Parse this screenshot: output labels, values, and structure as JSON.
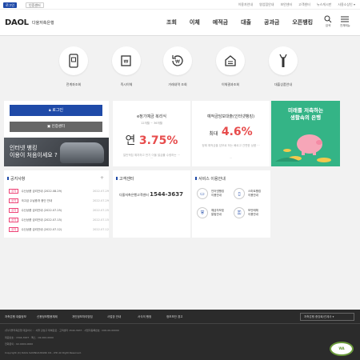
{
  "topbar": {
    "login_label": "로그인",
    "cert_label": "인증센터",
    "links": [
      "이용자안내",
      "영업점안내",
      "보안센터",
      "고객센터",
      "뉴스게시판",
      "고객상담 ▾"
    ],
    "lang_label": "사용소상인 ▾"
  },
  "header": {
    "logo": "DAOL",
    "logo_sub": "다올저축은행",
    "nav": [
      "조회",
      "이체",
      "예적금",
      "대출",
      "공과금",
      "오픈뱅킹"
    ],
    "search_label": "검색",
    "menu_label": "전체메뉴"
  },
  "quick_menu": [
    {
      "label": "전계좌조회",
      "icon": "phone-account-icon"
    },
    {
      "label": "즉시이체",
      "icon": "transfer-doc-icon"
    },
    {
      "label": "거래내역 조회",
      "icon": "history-icon"
    },
    {
      "label": "이체결과조회",
      "icon": "house-result-icon"
    },
    {
      "label": "대출상품안내",
      "icon": "loan-tool-icon"
    }
  ],
  "login_box": {
    "login": "로그인",
    "cert": "인증센터"
  },
  "banner_dark": {
    "line1": "인터넷 뱅킹",
    "line2": "이용이 처음이세요 ?"
  },
  "products": [
    {
      "title": "e정기예금 복리식",
      "sub": "12개월 ~ 36개월",
      "rate_prefix": "연",
      "rate": "3.75%",
      "desc": "일반적립 예치하고 반기 이율 발급률 수령하는 ···",
      "more": "···"
    },
    {
      "title": "예적금담보대출(인터넷뱅킹)",
      "sub": "",
      "rate_prefix": "최대",
      "rate": "4.6%",
      "desc": "정해 예적금을 담보로 하는 빠르고 간편한 상품 ···",
      "more": "···"
    }
  ],
  "green_banner": {
    "line1": "미래를 저축하는",
    "line2": "생활속의 은행"
  },
  "notice": {
    "title": "공지사항",
    "items": [
      {
        "tag": "공지",
        "text": "수신상품 금리안내 (2022.08.29)",
        "date": "2022.07.29"
      },
      {
        "tag": "공지",
        "text": "국고금 수납중개 중단 안내",
        "date": "2022.07.29"
      },
      {
        "tag": "공지",
        "text": "수신상품 금리안내 (2022.07.25)",
        "date": "2022.07.25"
      },
      {
        "tag": "공지",
        "text": "수신상품 금리안내 (2022.07.15)",
        "date": "2022.07.15"
      },
      {
        "tag": "공지",
        "text": "수신상품 금리안내 (2022.07.12)",
        "date": "2022.07.12"
      }
    ]
  },
  "cs": {
    "title": "고객센터",
    "label": "다올저축은행고객센터",
    "phone": "1544-3637"
  },
  "service": {
    "title": "서비스 이용안내",
    "items": [
      {
        "label1": "인터넷뱅킹",
        "label2": "이용안내",
        "icon": "monitor-icon"
      },
      {
        "label1": "스마트뱅킹",
        "label2": "이용안내",
        "icon": "mobile-icon"
      },
      {
        "label1": "예금자보호",
        "label2": "알림안내",
        "icon": "shield-icon"
      },
      {
        "label1": "보안매체",
        "label2": "이용안내",
        "icon": "otp-icon"
      }
    ]
  },
  "footer": {
    "menu": [
      "저축은행 대출정보",
      "신용정보활용체제",
      "개인정보처리방침",
      "사업장 안내",
      "서식의 행정",
      "정보보안 경고"
    ],
    "family_site": "저축은행 중앙회/관계사 ▾",
    "info1": "(주)다올저축은행 대표이사 : · 서울 강남구 테헤란로 · 고객센터 1544-3637 · 사업자등록번호 : 000-00-00000",
    "info2": "대표번호 : 1544-3637 · 팩스 : 02-000-0000",
    "info3": "전화문의 : 02-0000-0000",
    "copyright": "Copyright (C) DAOL SAVINGS BANK CO., LTD All Right Reserved.",
    "badge": "WA"
  },
  "colors": {
    "primary": "#1f4aa8",
    "accent_red": "#e74c4c",
    "green": "#34b486",
    "footer_bg": "#2b2b2b"
  }
}
